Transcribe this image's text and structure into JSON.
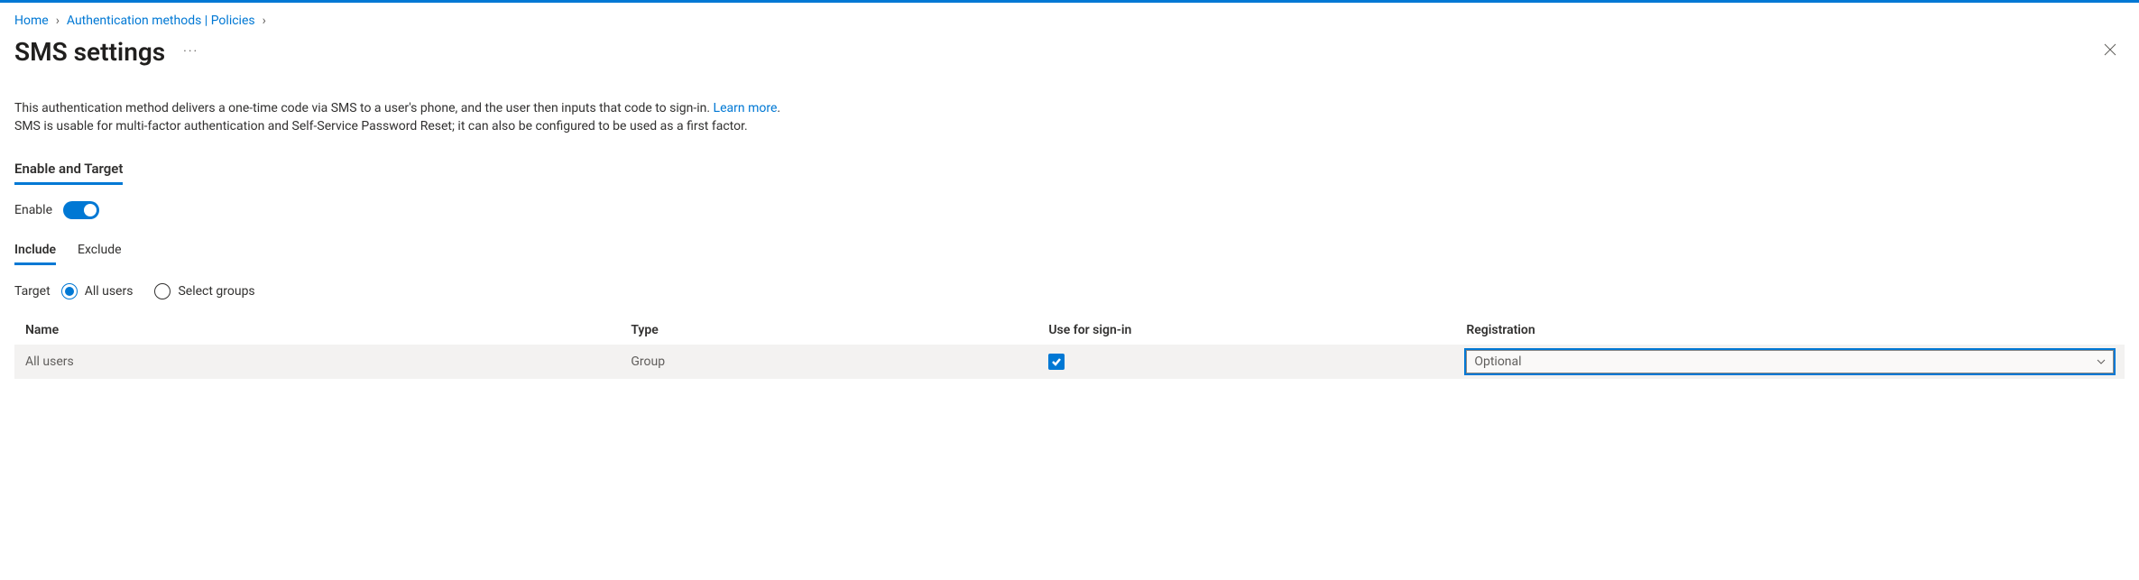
{
  "breadcrumb": {
    "home": "Home",
    "methods": "Authentication methods | Policies"
  },
  "title": "SMS settings",
  "description": {
    "line1_pre": "This authentication method delivers a one-time code via SMS to a user's phone, and the user then inputs that code to sign-in. ",
    "learn_more": "Learn more",
    "line2": "SMS is usable for multi-factor authentication and Self-Service Password Reset; it can also be configured to be used as a first factor."
  },
  "section_tab": "Enable and Target",
  "enable": {
    "label": "Enable",
    "value": true
  },
  "sub_tabs": {
    "include": "Include",
    "exclude": "Exclude"
  },
  "target": {
    "label": "Target",
    "all_users": "All users",
    "select_groups": "Select groups",
    "selected": "all_users"
  },
  "columns": {
    "name": "Name",
    "type": "Type",
    "signin": "Use for sign-in",
    "registration": "Registration"
  },
  "row": {
    "name": "All users",
    "type": "Group",
    "signin_checked": true,
    "registration_value": "Optional"
  }
}
